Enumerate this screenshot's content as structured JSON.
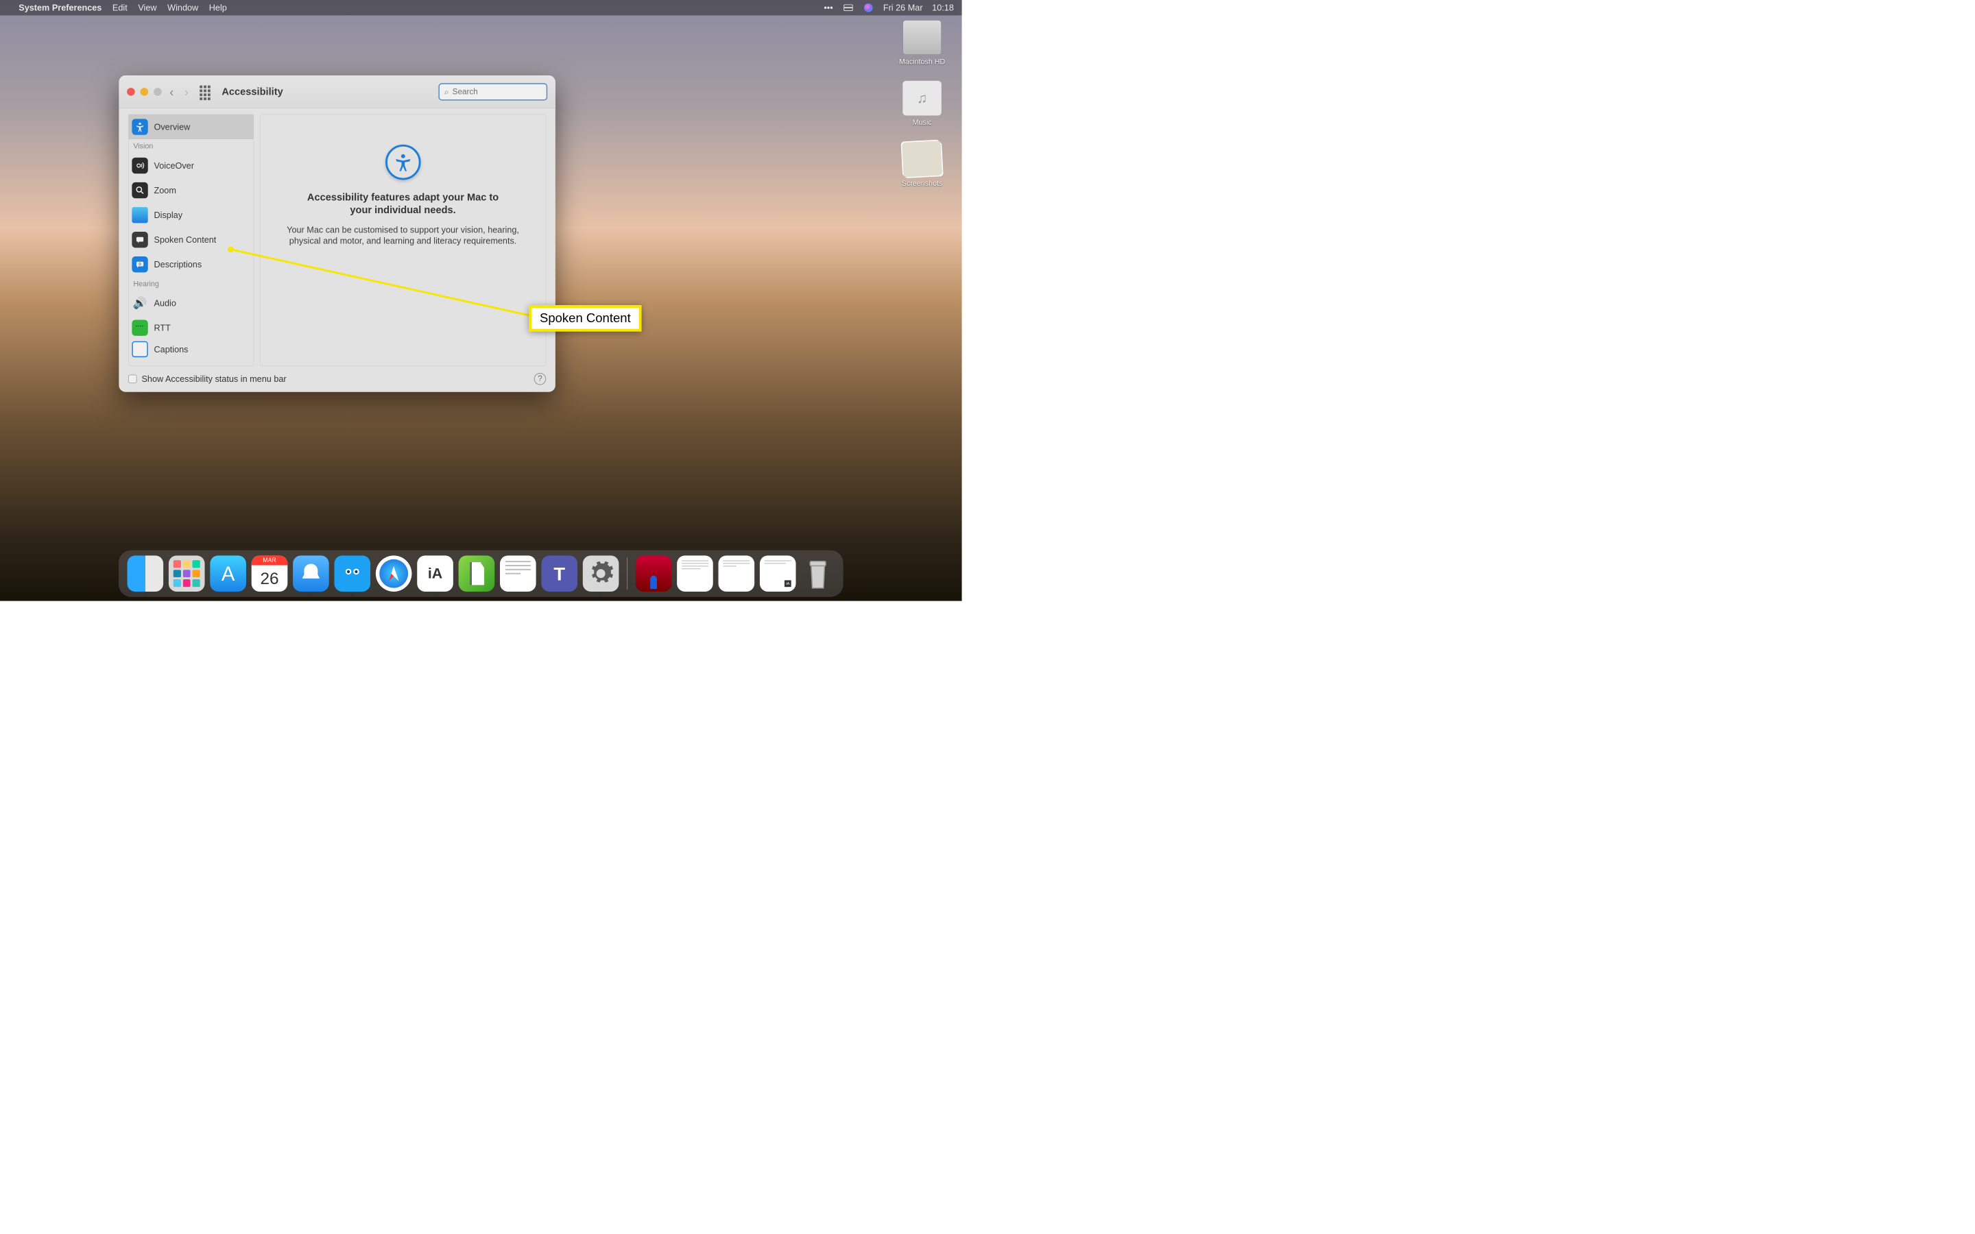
{
  "menubar": {
    "app_name": "System Preferences",
    "items": [
      "Edit",
      "View",
      "Window",
      "Help"
    ],
    "date": "Fri 26 Mar",
    "time": "10:18"
  },
  "desktop_icons": [
    {
      "label": "Macintosh HD",
      "kind": "disk"
    },
    {
      "label": "Music",
      "kind": "folder"
    },
    {
      "label": "Screenshots",
      "kind": "folder"
    }
  ],
  "window": {
    "title": "Accessibility",
    "search_placeholder": "Search",
    "sidebar": {
      "selected": "overview",
      "items": [
        {
          "id": "overview",
          "label": "Overview",
          "bg": "#1b83e8"
        }
      ],
      "categories": [
        {
          "label": "Vision",
          "items": [
            {
              "id": "voiceover",
              "label": "VoiceOver",
              "bg": "#2b2b2b"
            },
            {
              "id": "zoom",
              "label": "Zoom",
              "bg": "#2b2b2b"
            },
            {
              "id": "display",
              "label": "Display",
              "bg": "#2dc0ff"
            },
            {
              "id": "spoken",
              "label": "Spoken Content",
              "bg": "#3b3b3b"
            },
            {
              "id": "descriptions",
              "label": "Descriptions",
              "bg": "#1b83e8"
            }
          ]
        },
        {
          "label": "Hearing",
          "items": [
            {
              "id": "audio",
              "label": "Audio",
              "bg": "#cfcfcf"
            },
            {
              "id": "rtt",
              "label": "RTT",
              "bg": "#2fbf3a"
            },
            {
              "id": "captions",
              "label": "Captions",
              "bg": "#1b83e8"
            }
          ]
        }
      ]
    },
    "content": {
      "headline": "Accessibility features adapt your Mac to your individual needs.",
      "subline": "Your Mac can be customised to support your vision, hearing, physical and motor, and learning and literacy requirements."
    },
    "footer_checkbox_label": "Show Accessibility status in menu bar"
  },
  "annotation": {
    "label": "Spoken Content"
  },
  "dock_apps": [
    "finder",
    "launchpad",
    "appstore",
    "calendar",
    "mail",
    "tweetbot",
    "safari",
    "iawriter",
    "calibre",
    "textedit",
    "teams",
    "systemprefs"
  ],
  "dock_right": [
    "sim",
    "doc1",
    "doc2",
    "doc3"
  ]
}
